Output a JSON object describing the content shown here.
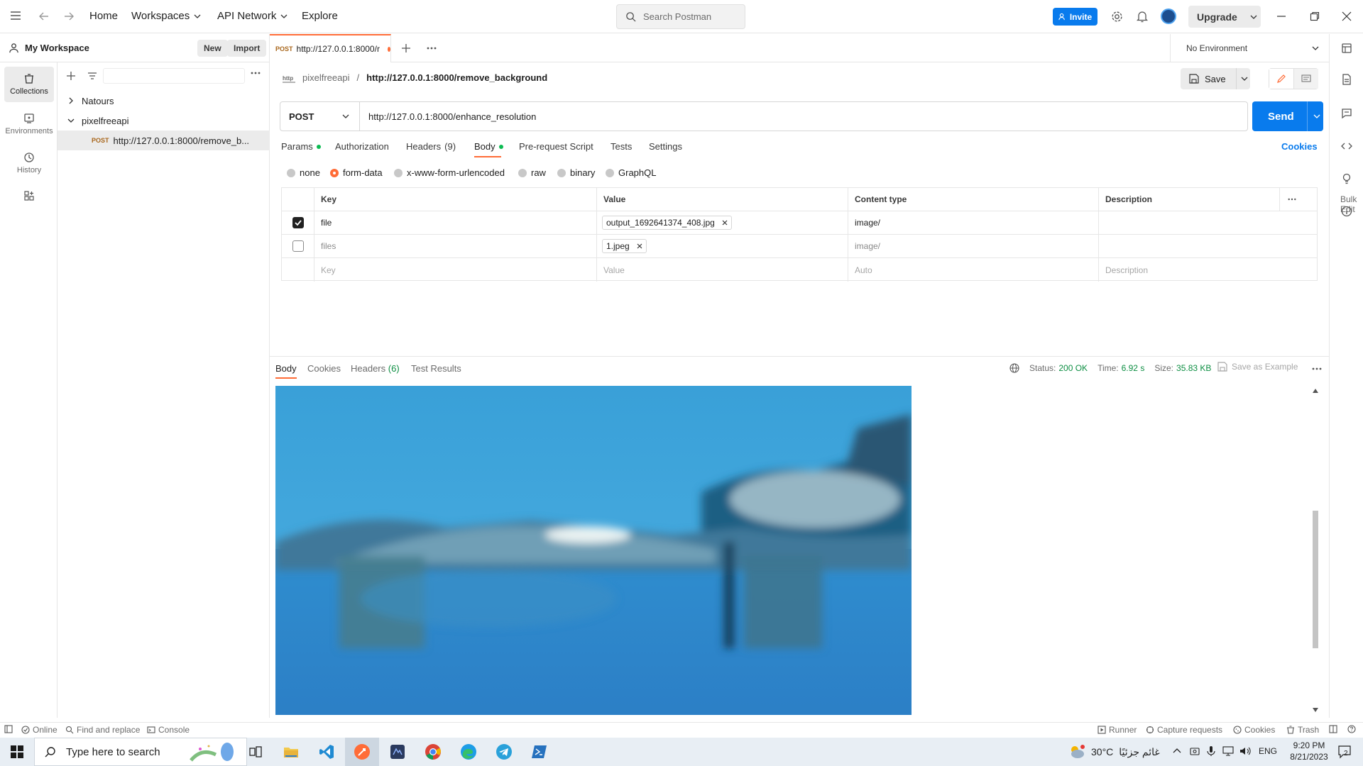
{
  "titlebar": {
    "home": "Home",
    "workspaces": "Workspaces",
    "api_network": "API Network",
    "explore": "Explore",
    "search_placeholder": "Search Postman",
    "invite": "Invite",
    "upgrade": "Upgrade"
  },
  "workspace": {
    "title": "My Workspace",
    "new": "New",
    "import": "Import"
  },
  "rail": {
    "collections": "Collections",
    "environments": "Environments",
    "history": "History"
  },
  "tree": {
    "item1": "Natours",
    "item2": "pixelfreeapi",
    "request_method": "POST",
    "request_name": "http://127.0.0.1:8000/remove_b..."
  },
  "tabs": {
    "method": "POST",
    "label": "http://127.0.0.1:8000/r"
  },
  "environment": "No Environment",
  "breadcrumb": {
    "collection": "pixelfreeapi",
    "separator": "/",
    "request": "http://127.0.0.1:8000/remove_background"
  },
  "save": "Save",
  "request": {
    "method": "POST",
    "url": "http://127.0.0.1:8000/enhance_resolution",
    "send": "Send"
  },
  "req_tabs": {
    "params": "Params",
    "authorization": "Authorization",
    "headers": "Headers",
    "headers_count": "(9)",
    "body": "Body",
    "prerequest": "Pre-request Script",
    "tests": "Tests",
    "settings": "Settings",
    "cookies": "Cookies"
  },
  "body_types": {
    "none": "none",
    "form_data": "form-data",
    "urlencoded": "x-www-form-urlencoded",
    "raw": "raw",
    "binary": "binary",
    "graphql": "GraphQL"
  },
  "table": {
    "headers": {
      "key": "Key",
      "value": "Value",
      "content_type": "Content type",
      "description": "Description",
      "bulk_edit": "Bulk Edit"
    },
    "rows": [
      {
        "checked": true,
        "key": "file",
        "value": "output_1692641374_408.jpg",
        "content_type": "image/"
      },
      {
        "checked": false,
        "key": "files",
        "value": "1.jpeg",
        "content_type": "image/"
      }
    ],
    "placeholder": {
      "key": "Key",
      "value": "Value",
      "content_type": "Auto",
      "description": "Description"
    }
  },
  "response": {
    "tabs": {
      "body": "Body",
      "cookies": "Cookies",
      "headers": "Headers",
      "headers_count": "(6)",
      "test_results": "Test Results"
    },
    "status_label": "Status:",
    "status": "200 OK",
    "time_label": "Time:",
    "time": "6.92 s",
    "size_label": "Size:",
    "size": "35.83 KB",
    "save_example": "Save as Example"
  },
  "statusbar": {
    "online": "Online",
    "find_replace": "Find and replace",
    "console": "Console",
    "runner": "Runner",
    "capture": "Capture requests",
    "cookies": "Cookies",
    "trash": "Trash"
  },
  "taskbar": {
    "search": "Type here to search",
    "weather": "30°C",
    "weather_desc": "غائم جزئيًا",
    "lang": "ENG",
    "time": "9:20 PM",
    "date": "8/21/2023",
    "notifications": "2"
  },
  "colors": {
    "accent": "#097bed",
    "orange": "#ff6c37",
    "status_green": "#0cbb52"
  }
}
